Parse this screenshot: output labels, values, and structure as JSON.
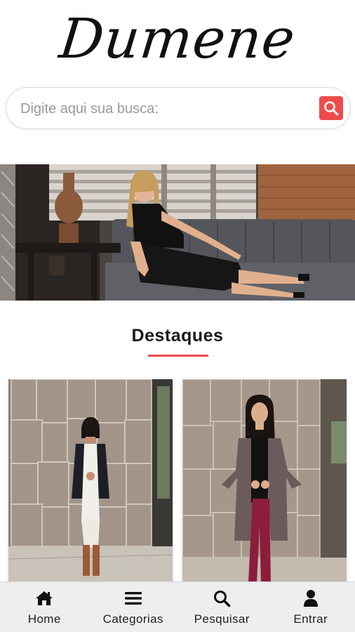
{
  "brand": {
    "logo_text": "Dumene"
  },
  "search": {
    "placeholder": "Digite aqui sua busca:",
    "value": "",
    "button_icon": "search-icon",
    "button_color": "#ef4b4b"
  },
  "banner": {
    "description_icon": "hero-banner"
  },
  "highlights": {
    "title": "Destaques",
    "accent_color": "#ef4b4b",
    "products": [
      {
        "icon": "product-image"
      },
      {
        "icon": "product-image"
      }
    ]
  },
  "bottom_nav": {
    "items": [
      {
        "label": "Home",
        "icon": "home-icon"
      },
      {
        "label": "Categorias",
        "icon": "menu-icon"
      },
      {
        "label": "Pesquisar",
        "icon": "search-icon"
      },
      {
        "label": "Entrar",
        "icon": "user-icon"
      }
    ]
  }
}
